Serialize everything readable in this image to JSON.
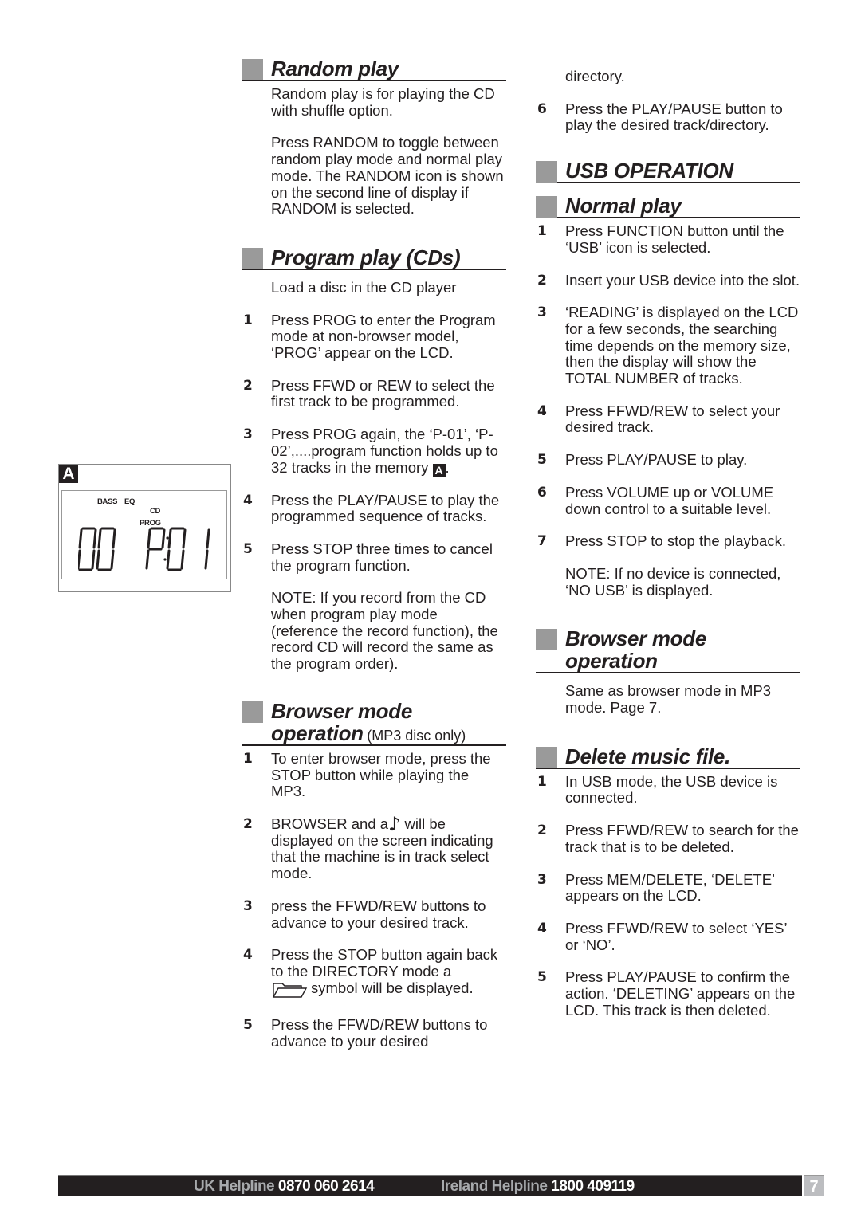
{
  "lcd_figure": {
    "label": "A",
    "indicators": {
      "bass": "BASS",
      "eq": "EQ",
      "cd": "CD",
      "prog": "PROG"
    },
    "display_left": "00",
    "display_right": "P-01"
  },
  "middle_column": {
    "random_play": {
      "title": "Random play",
      "paragraphs": [
        "Random play is for playing the CD with shuffle option.",
        "Press RANDOM to toggle between random play mode and normal play mode. The RANDOM icon is shown on the second line of display if RANDOM is selected."
      ]
    },
    "program_play": {
      "title": "Program play (CDs)",
      "intro": "Load a disc in the CD player",
      "steps": [
        {
          "num": "1",
          "text": "Press PROG to enter the Program mode at non-browser model, ‘PROG’ appear on the LCD."
        },
        {
          "num": "2",
          "text": "Press FFWD or REW to select the first track to be programmed."
        },
        {
          "num": "3",
          "text": "Press PROG again, the ‘P-01’, ‘P-02’,....program function holds up to 32 tracks in the memory",
          "ref": "A"
        },
        {
          "num": "4",
          "text": "Press the PLAY/PAUSE to play the programmed sequence of tracks."
        },
        {
          "num": "5",
          "text": "Press STOP three times to cancel the program function."
        }
      ],
      "note": "NOTE: If you record from the CD when program play mode (reference the record function), the record CD will record the same as the program order)."
    },
    "browser_mode": {
      "title_line1": "Browser mode",
      "title_line2": "operation",
      "subtitle": "(MP3 disc only)",
      "steps": [
        {
          "num": "1",
          "text": "To enter browser mode, press the STOP button while playing the MP3."
        },
        {
          "num": "2",
          "text_before": "BROWSER and a",
          "icon": "♪",
          "text_after": "will be displayed on the screen indicating that the machine is in track select mode."
        },
        {
          "num": "3",
          "text": "press the FFWD/REW buttons to advance to your desired track."
        },
        {
          "num": "4",
          "text_before": "Press the STOP button again back to the DIRECTORY mode a",
          "text_after": "symbol will be displayed."
        },
        {
          "num": "5",
          "text": "Press the FFWD/REW buttons to advance to your desired"
        }
      ]
    }
  },
  "right_column": {
    "continued": "directory.",
    "continued_step": {
      "num": "6",
      "text": "Press the PLAY/PAUSE button to play the desired track/directory."
    },
    "usb_operation": {
      "title": "USB OPERATION"
    },
    "normal_play": {
      "title": "Normal play",
      "steps": [
        {
          "num": "1",
          "text": "Press FUNCTION button until the ‘USB’ icon is selected."
        },
        {
          "num": "2",
          "text": "Insert your USB device into the slot."
        },
        {
          "num": "3",
          "text": "‘READING’ is displayed on the LCD for a few seconds, the searching time depends on the memory size, then the display will show the TOTAL NUMBER of tracks."
        },
        {
          "num": "4",
          "text": "Press FFWD/REW to select your desired track."
        },
        {
          "num": "5",
          "text": "Press PLAY/PAUSE to play."
        },
        {
          "num": "6",
          "text": "Press VOLUME up or VOLUME down control to a suitable level."
        },
        {
          "num": "7",
          "text": "Press STOP to stop the playback."
        }
      ],
      "note": "NOTE: If no device is connected, ‘NO USB’ is displayed."
    },
    "browser_mode": {
      "title_line1": "Browser mode",
      "title_line2": "operation",
      "text": "Same as browser mode in MP3 mode. Page 7."
    },
    "delete_file": {
      "title": "Delete music file.",
      "steps": [
        {
          "num": "1",
          "text": "In USB mode, the USB device is connected."
        },
        {
          "num": "2",
          "text": "Press FFWD/REW to search for the track that is to be deleted."
        },
        {
          "num": "3",
          "text": "Press MEM/DELETE, ‘DELETE’ appears on the LCD."
        },
        {
          "num": "4",
          "text": "Press FFWD/REW to select ‘YES’ or ‘NO’."
        },
        {
          "num": "5",
          "text": "Press PLAY/PAUSE to confirm the action. ‘DELETING’ appears on the LCD. This track is then deleted."
        }
      ]
    }
  },
  "footer": {
    "uk_label": "UK Helpline",
    "uk_number": "0870 060 2614",
    "ireland_label": "Ireland Helpline",
    "ireland_number": "1800 409119",
    "page_number": "7"
  }
}
